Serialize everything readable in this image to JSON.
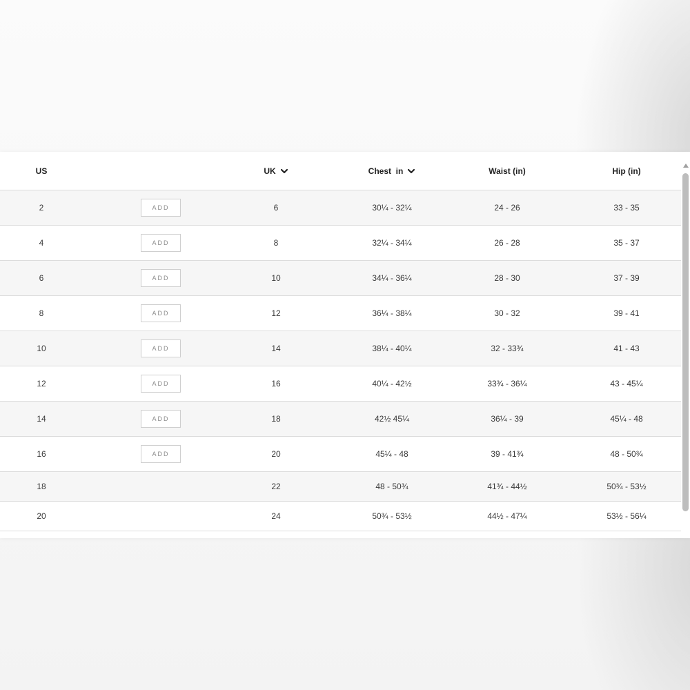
{
  "size_table": {
    "headers": {
      "us": "US",
      "uk": "UK",
      "chest": "Chest  in",
      "waist": "Waist (in)",
      "hip": "Hip (in)"
    },
    "add_label": "ADD",
    "rows": [
      {
        "us": "2",
        "uk": "6",
        "chest": "30¼ - 32¼",
        "waist": "24 - 26",
        "hip": "33 - 35",
        "has_add": true
      },
      {
        "us": "4",
        "uk": "8",
        "chest": "32¼ - 34¼",
        "waist": "26 - 28",
        "hip": "35 - 37",
        "has_add": true
      },
      {
        "us": "6",
        "uk": "10",
        "chest": "34¼ - 36¼",
        "waist": "28 - 30",
        "hip": "37 - 39",
        "has_add": true
      },
      {
        "us": "8",
        "uk": "12",
        "chest": "36¼ - 38¼",
        "waist": "30 - 32",
        "hip": "39 - 41",
        "has_add": true
      },
      {
        "us": "10",
        "uk": "14",
        "chest": "38¼ - 40¼",
        "waist": "32 - 33¾",
        "hip": "41 - 43",
        "has_add": true
      },
      {
        "us": "12",
        "uk": "16",
        "chest": "40¼ - 42½",
        "waist": "33¾ - 36¼",
        "hip": "43 - 45¼",
        "has_add": true
      },
      {
        "us": "14",
        "uk": "18",
        "chest": "42½ 45¼",
        "waist": "36¼ - 39",
        "hip": "45¼ - 48",
        "has_add": true
      },
      {
        "us": "16",
        "uk": "20",
        "chest": "45¼ - 48",
        "waist": "39 - 41¾",
        "hip": "48 - 50¾",
        "has_add": true
      },
      {
        "us": "18",
        "uk": "22",
        "chest": "48 - 50¾",
        "waist": "41¾ - 44½",
        "hip": "50¾ - 53½",
        "has_add": false
      },
      {
        "us": "20",
        "uk": "24",
        "chest": "50¾ - 53½",
        "waist": "44½ - 47¼",
        "hip": "53½ - 56¼",
        "has_add": false
      }
    ]
  },
  "icons": {
    "uk_sort": "chevron-down-icon",
    "chest_sort": "chevron-down-icon",
    "scroll_up": "arrow-up-icon"
  },
  "colors": {
    "row_shade": "#f6f6f6",
    "border": "#dcdcdc",
    "button_text": "#8a8a8a",
    "scroll_thumb": "#bdbdbd"
  }
}
